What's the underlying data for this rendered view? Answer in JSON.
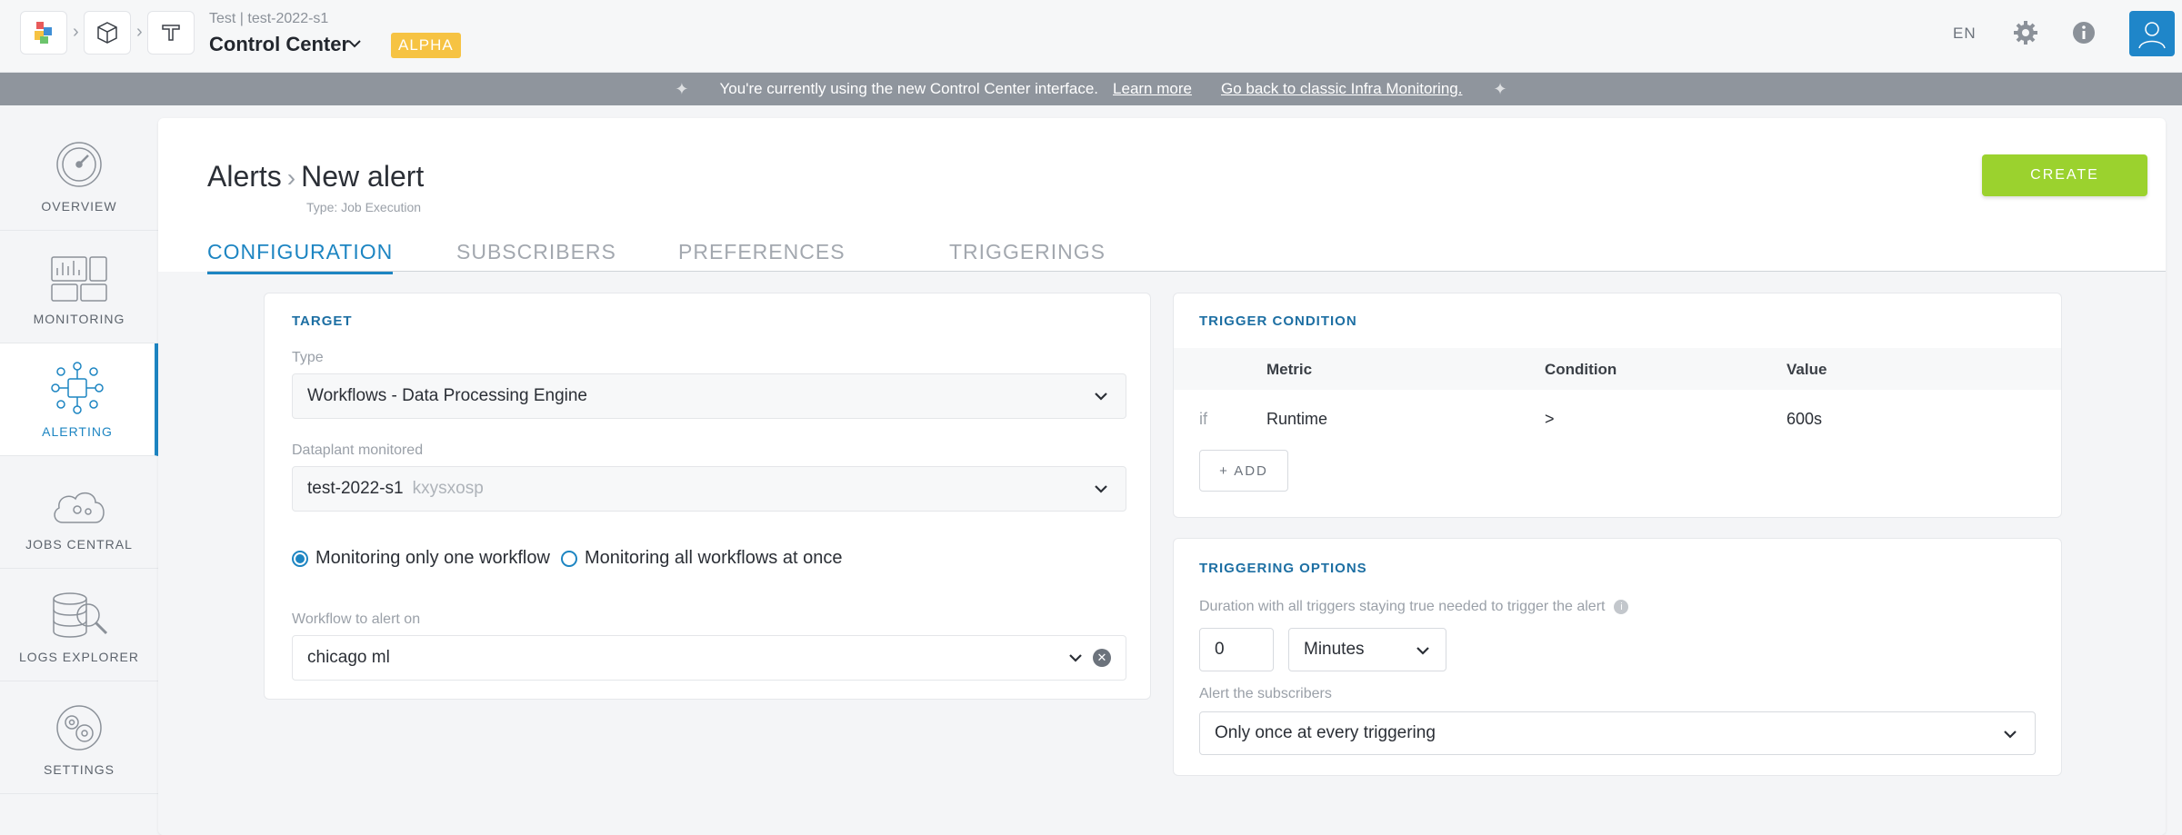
{
  "header": {
    "project_path": "Test | test-2022-s1",
    "project_title": "Control Center",
    "badge": "ALPHA",
    "language": "EN",
    "icons": [
      "dataplatform-logo-icon",
      "box-icon",
      "pipeline-icon",
      "gear-icon",
      "info-icon",
      "user-avatar-icon"
    ]
  },
  "banner": {
    "text": "You're currently using the new Control Center interface.",
    "learn_more": "Learn more",
    "go_back": "Go back to classic Infra Monitoring."
  },
  "sidebar": {
    "items": [
      {
        "label": "OVERVIEW",
        "icon": "gauge-icon"
      },
      {
        "label": "MONITORING",
        "icon": "dashboard-icon"
      },
      {
        "label": "ALERTING",
        "icon": "alert-network-icon",
        "active": true
      },
      {
        "label": "JOBS CENTRAL",
        "icon": "cloud-jobs-icon"
      },
      {
        "label": "LOGS EXPLORER",
        "icon": "database-search-icon"
      },
      {
        "label": "SETTINGS",
        "icon": "gears-icon"
      }
    ]
  },
  "page": {
    "breadcrumb_root": "Alerts",
    "breadcrumb_current": "New alert",
    "subtitle": "Type: Job Execution",
    "create_label": "CREATE",
    "tabs": [
      "CONFIGURATION",
      "SUBSCRIBERS",
      "PREFERENCES",
      "TRIGGERINGS"
    ]
  },
  "target": {
    "title": "TARGET",
    "type_label": "Type",
    "type_value": "Workflows - Data Processing Engine",
    "dataplant_label": "Dataplant monitored",
    "dataplant_value": "test-2022-s1",
    "dataplant_id": "kxysxosp",
    "radio_one": "Monitoring only one workflow",
    "radio_all": "Monitoring all workflows at once",
    "workflow_label": "Workflow to alert on",
    "workflow_value": "chicago ml"
  },
  "trigger": {
    "title": "TRIGGER CONDITION",
    "col_metric": "Metric",
    "col_condition": "Condition",
    "col_value": "Value",
    "row_if": "if",
    "row_metric": "Runtime",
    "row_condition": ">",
    "row_value": "600s",
    "add_label": "ADD"
  },
  "options": {
    "title": "TRIGGERING OPTIONS",
    "duration_label": "Duration with all triggers staying true needed to trigger the alert",
    "duration_value": "0",
    "duration_unit": "Minutes",
    "subscribers_label": "Alert the subscribers",
    "subscribers_value": "Only once at every triggering"
  },
  "colors": {
    "accent": "#1d85c2",
    "create": "#9bd22e",
    "alpha": "#f6c343",
    "banner": "#8f959d"
  }
}
